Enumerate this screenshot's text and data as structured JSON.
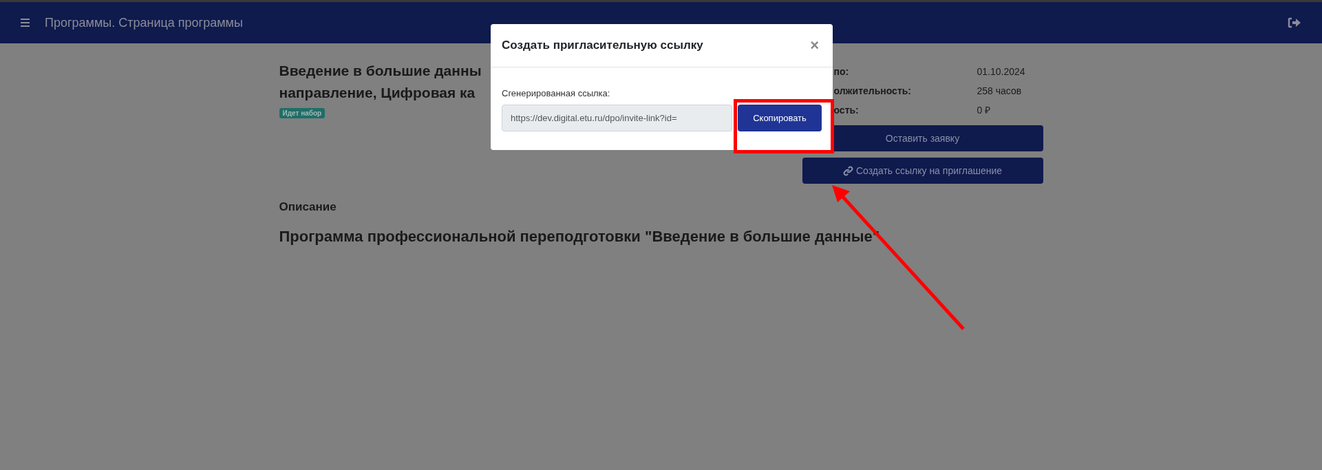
{
  "topbar": {
    "title": "Программы. Страница программы"
  },
  "program": {
    "title_lines": [
      "Введение в большие данны",
      "направление, Цифровая ка"
    ],
    "status": "Идет набор"
  },
  "info": [
    {
      "label": "по:",
      "value": "01.10.2024"
    },
    {
      "label": "олжительность:",
      "value": "258 часов"
    },
    {
      "label": "ость:",
      "value": "0 ₽"
    }
  ],
  "actions": [
    {
      "kind": "plain",
      "label": "Оставить заявку"
    },
    {
      "kind": "link",
      "label": "Создать ссылку на приглашение"
    }
  ],
  "description": {
    "heading": "Описание",
    "text": "Программа профессиональной переподготовки \"Введение в большие данные\""
  },
  "modal": {
    "title": "Создать пригласительную ссылку",
    "close": "×",
    "field_label": "Сгенерированная ссылка:",
    "link": "https://dev.digital.etu.ru/dpo/invite-link?id=",
    "copy_button": "Скопировать"
  }
}
